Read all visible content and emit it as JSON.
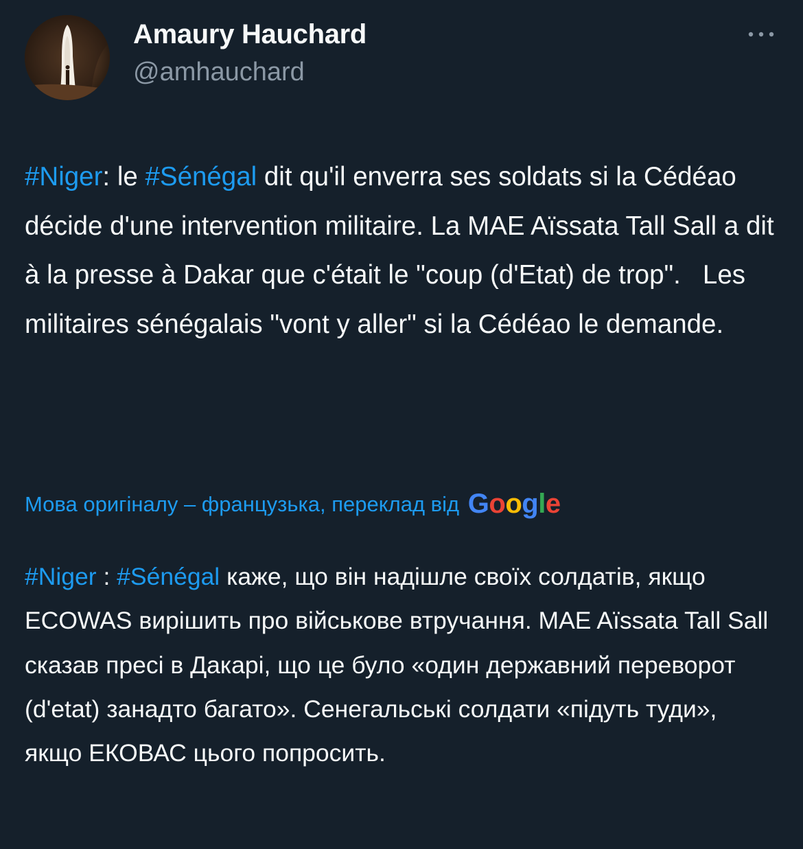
{
  "author": {
    "display_name": "Amaury Hauchard",
    "handle": "@amhauchard",
    "avatar_icon": "profile-photo"
  },
  "more_icon": "more-options-icon",
  "tweet": {
    "hashtag_niger": "#Niger",
    "seg1": ": le ",
    "hashtag_senegal": "#Sénégal",
    "seg2": " dit qu'il enverra ses soldats si la Cédéao décide d'une intervention militaire. La MAE Aïssata Tall Sall a dit à la presse à Dakar que c'était le \"coup (d'Etat) de trop\".   Les militaires sénégalais \"vont y aller\" si la Cédéao le demande."
  },
  "translation": {
    "label": "Мова оригіналу – французька, переклад від",
    "provider": "Google",
    "hashtag_niger": "#Niger",
    "seg1": " : ",
    "hashtag_senegal": "#Sénégal",
    "seg2": " каже, що він надішле своїх солдатів, якщо ECOWAS вирішить про військове втручання. MAE Aïssata Tall Sall сказав пресі в Дакарі, що це було «один державний переворот (d'etat) занадто багато». Сенегальські солдати «підуть туди», якщо ЕКОВАС цього попросить."
  },
  "colors": {
    "background": "#15202b",
    "text": "#f7f9f9",
    "secondary": "#8b98a5",
    "accent": "#1d9bf0"
  }
}
